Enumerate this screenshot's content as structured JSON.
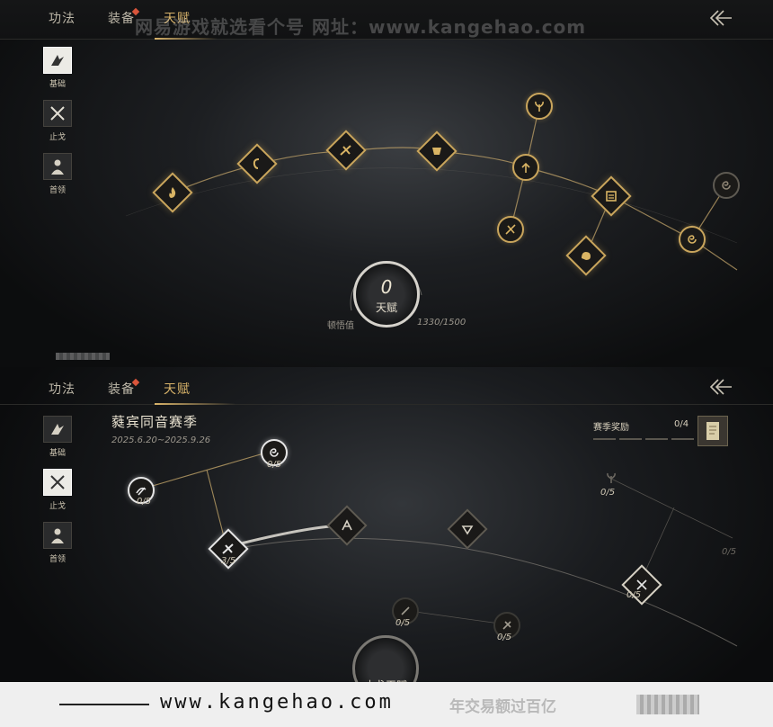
{
  "watermark_top": "网易游戏就选看个号   网址：www.kangehao.com",
  "tabs": [
    "功法",
    "装备",
    "天赋"
  ],
  "sidebar": [
    "基础",
    "止戈",
    "首领"
  ],
  "top_panel": {
    "dial_value": "0",
    "dial_label": "天赋",
    "left_caption": "顿悟值",
    "right_caption": "1330/1500"
  },
  "bottom_panel": {
    "season_title": "蕤宾同音赛季",
    "season_dates": "2025.6.20~2025.9.26",
    "reward_label": "赛季奖励",
    "reward_count": "0/4",
    "node_counts": [
      "0/5",
      "0/5",
      "3/5",
      "0/5",
      "0/5",
      "0/5",
      "0/5",
      "0/5"
    ],
    "dial_label": "止戈天赋"
  },
  "footer": {
    "site": "www.kangehao.com",
    "slogan": "年交易额过百亿"
  },
  "colors": {
    "gold": "#c9a55c",
    "active_tab": "#d8b36a",
    "badge": "#d9553b"
  }
}
